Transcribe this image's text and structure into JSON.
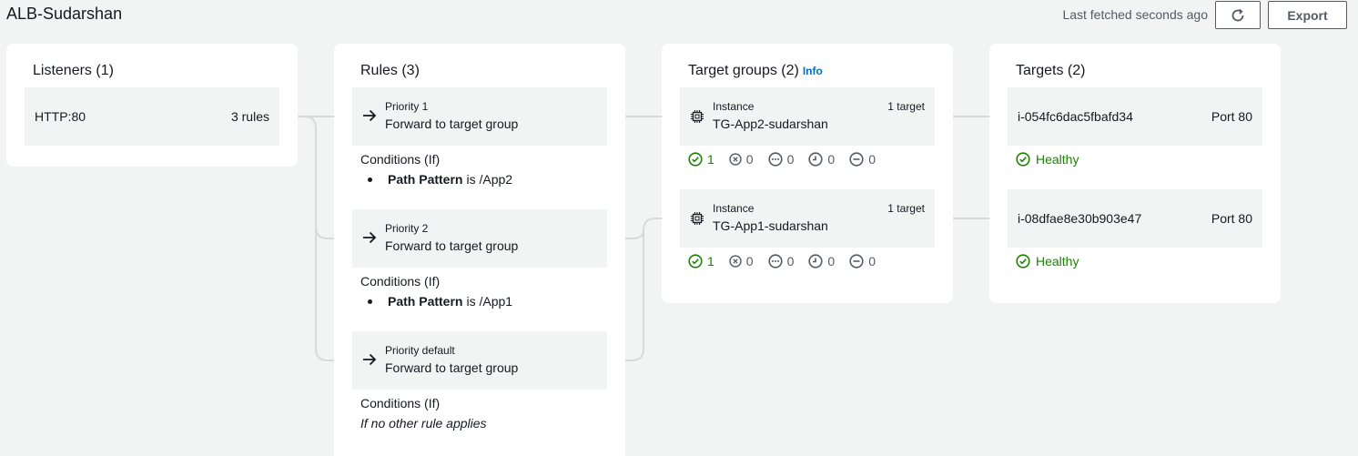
{
  "header": {
    "title": "ALB-Sudarshan",
    "last_fetched": "Last fetched seconds ago",
    "export_label": "Export"
  },
  "listeners": {
    "title": "Listeners (1)",
    "items": [
      {
        "protocol": "HTTP:80",
        "rules": "3 rules"
      }
    ]
  },
  "rules": {
    "title": "Rules (3)",
    "conditions_label": "Conditions (If)",
    "items": [
      {
        "priority": "Priority 1",
        "action": "Forward to target group",
        "cond_key": "Path Pattern",
        "cond_rest": "is /App2"
      },
      {
        "priority": "Priority 2",
        "action": "Forward to target group",
        "cond_key": "Path Pattern",
        "cond_rest": "is /App1"
      },
      {
        "priority": "Priority default",
        "action": "Forward to target group",
        "cond_default": "If no other rule applies"
      }
    ]
  },
  "target_groups": {
    "title": "Target groups (2)",
    "info": "Info",
    "items": [
      {
        "type": "Instance",
        "count": "1 target",
        "name": "TG-App2-sudarshan",
        "healthy": "1",
        "unhealthy": "0",
        "unused": "0",
        "initial": "0",
        "draining": "0"
      },
      {
        "type": "Instance",
        "count": "1 target",
        "name": "TG-App1-sudarshan",
        "healthy": "1",
        "unhealthy": "0",
        "unused": "0",
        "initial": "0",
        "draining": "0"
      }
    ]
  },
  "targets": {
    "title": "Targets (2)",
    "items": [
      {
        "id": "i-054fc6dac5fbafd34",
        "port": "Port 80",
        "status": "Healthy"
      },
      {
        "id": "i-08dfae8e30b903e47",
        "port": "Port 80",
        "status": "Healthy"
      }
    ]
  },
  "colors": {
    "accent": "#0073bb",
    "healthy": "#1d8102",
    "muted": "#545b64",
    "background": "#f2f3f3"
  },
  "icons": {
    "refresh": "refresh-icon",
    "forward": "arrow-right-icon",
    "instance": "chip-icon",
    "healthy": "check-circle-icon",
    "unhealthy": "x-circle-icon",
    "unused": "ellipsis-circle-icon",
    "initial": "clock-icon",
    "draining": "minus-circle-icon"
  }
}
